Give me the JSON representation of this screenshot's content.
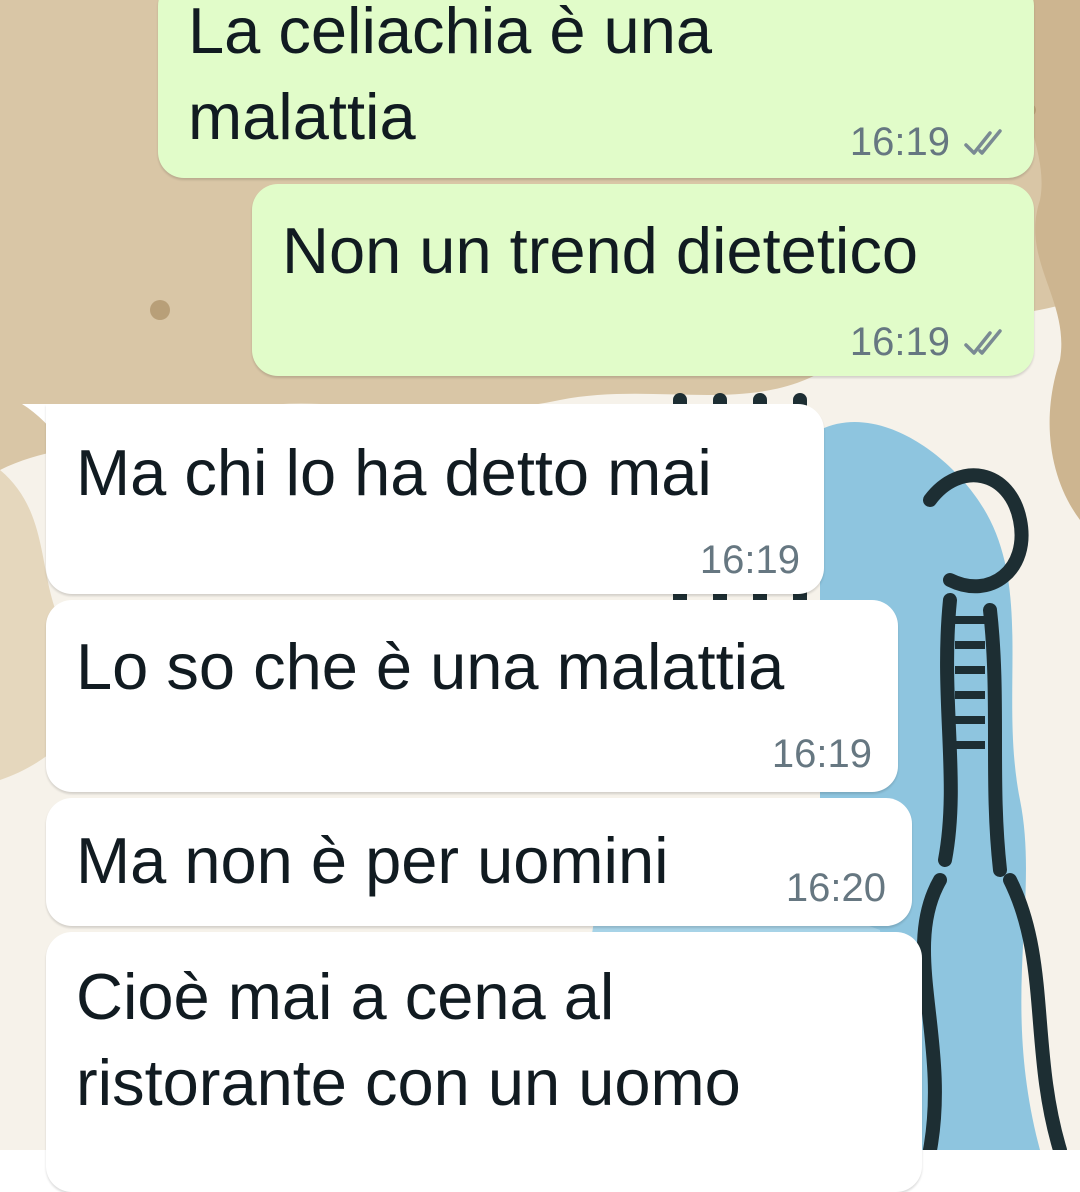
{
  "chat": {
    "messages": [
      {
        "direction": "outgoing",
        "text_lines": [
          "La celiachia è una",
          "malattia"
        ],
        "time": "16:19",
        "status": "read-double-check-icon"
      },
      {
        "direction": "outgoing",
        "text_lines": [
          "Non un trend dietetico"
        ],
        "time": "16:19",
        "status": "read-double-check-icon"
      },
      {
        "direction": "incoming",
        "text_lines": [
          "Ma chi lo ha detto mai"
        ],
        "time": "16:19"
      },
      {
        "direction": "incoming",
        "text_lines": [
          "Lo so che è una malattia"
        ],
        "time": "16:19"
      },
      {
        "direction": "incoming",
        "text_lines": [
          "Ma non è per uomini"
        ],
        "time": "16:20"
      },
      {
        "direction": "incoming",
        "text_lines": [
          "Cioè mai a cena al",
          "ristorante con un uomo"
        ],
        "time": ""
      }
    ]
  },
  "colors": {
    "outgoing_bubble": "#e1fcc9",
    "incoming_bubble": "#ffffff",
    "message_text": "#111b21",
    "meta_text": "#667781",
    "wallpaper_paper": "#d9c6a6",
    "wallpaper_blue": "#8ec5df",
    "wallpaper_ink": "#1d2e33"
  },
  "icons": {
    "read_receipt": "double-check-icon",
    "wallpaper": "sketch-illustration"
  }
}
